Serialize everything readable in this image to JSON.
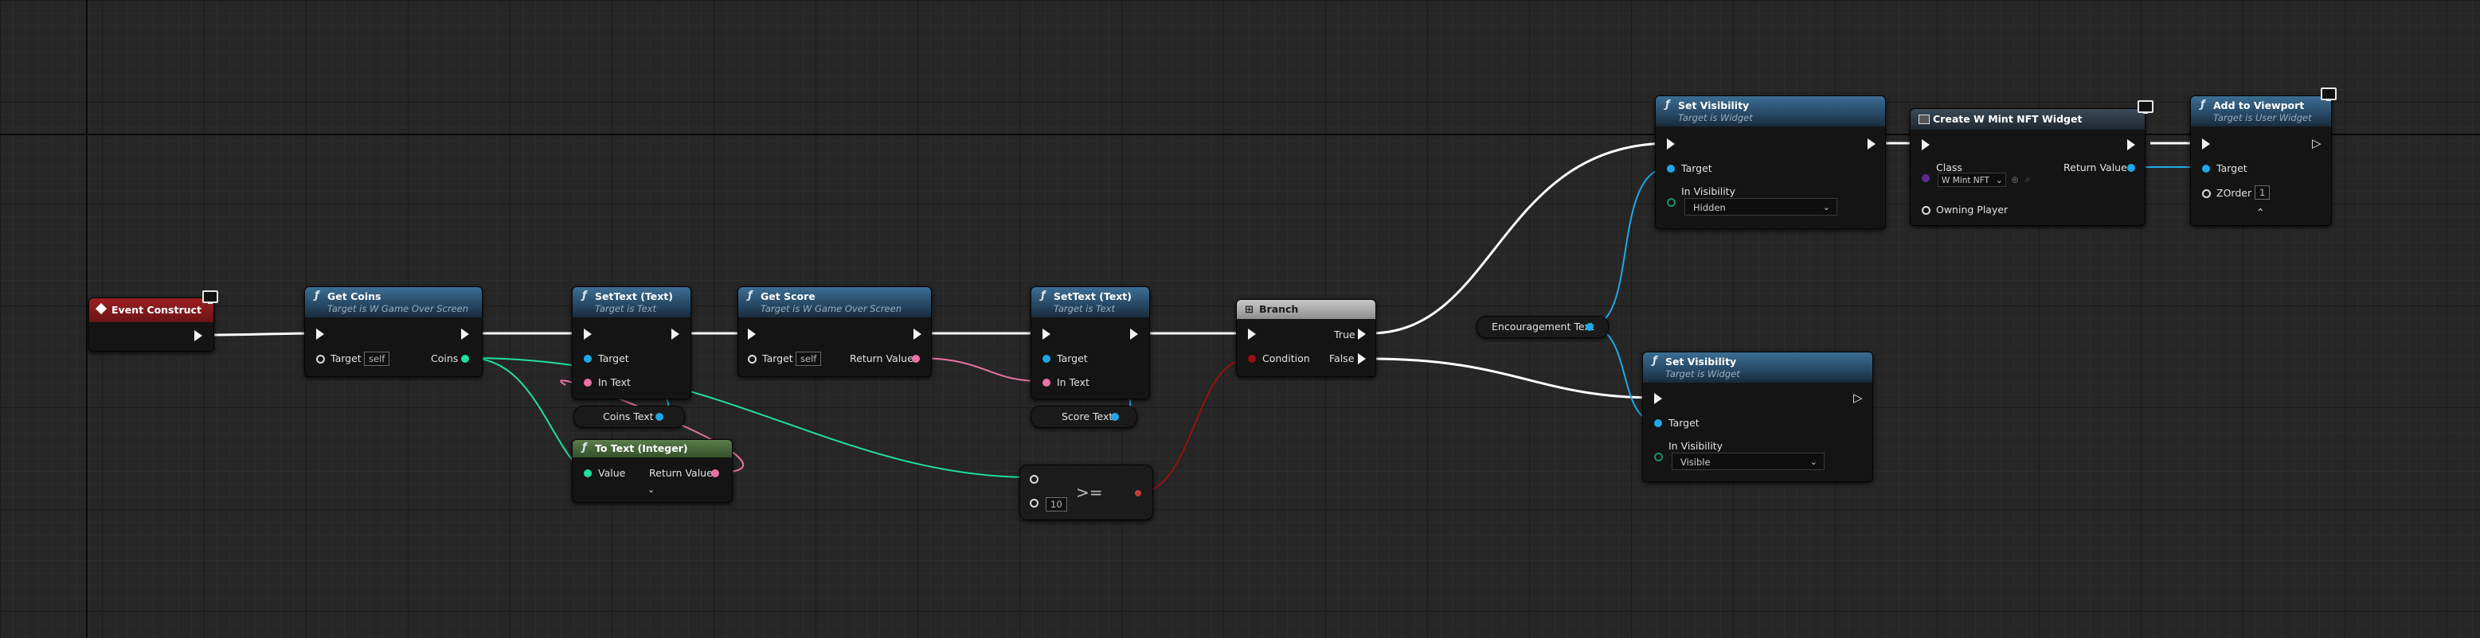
{
  "colors": {
    "canvas": "#262626",
    "exec_wire": "#ffffff",
    "object_pin": "#1fa8e6",
    "integer_pin": "#20dfa0",
    "text_pin": "#e873a4",
    "boolean_pin": "#9b0f0f",
    "function_header": "#3c6e93",
    "event_header": "#9c1f21",
    "conversion_header": "#5a7d4c"
  },
  "nodes": {
    "event_construct": {
      "title": "Event Construct",
      "icon": "event-diamond-icon"
    },
    "get_coins": {
      "title": "Get Coins",
      "subtitle": "Target is W Game Over Screen",
      "target_label": "Target",
      "target_value": "self",
      "output_label": "Coins"
    },
    "settext_coins": {
      "title": "SetText (Text)",
      "subtitle": "Target is Text",
      "target_label": "Target",
      "intext_label": "In Text"
    },
    "coins_text_var": {
      "label": "Coins Text"
    },
    "to_text_integer": {
      "title": "To Text (Integer)",
      "value_label": "Value",
      "return_label": "Return Value",
      "expand_icon": "chevron-down-icon"
    },
    "get_score": {
      "title": "Get Score",
      "subtitle": "Target is W Game Over Screen",
      "target_label": "Target",
      "target_value": "self",
      "return_label": "Return Value"
    },
    "settext_score": {
      "title": "SetText (Text)",
      "subtitle": "Target is Text",
      "target_label": "Target",
      "intext_label": "In Text"
    },
    "score_text_var": {
      "label": "Score Text"
    },
    "compare_gte": {
      "operator": ">=",
      "b_value": "10"
    },
    "branch": {
      "title": "Branch",
      "condition_label": "Condition",
      "true_label": "True",
      "false_label": "False"
    },
    "encouragement_text_var": {
      "label": "Encouragement Text"
    },
    "set_visibility_top": {
      "title": "Set Visibility",
      "subtitle": "Target is Widget",
      "target_label": "Target",
      "visibility_label": "In Visibility",
      "visibility_value": "Hidden"
    },
    "set_visibility_bottom": {
      "title": "Set Visibility",
      "subtitle": "Target is Widget",
      "target_label": "Target",
      "visibility_label": "In Visibility",
      "visibility_value": "Visible"
    },
    "create_widget": {
      "title": "Create W Mint NFT Widget",
      "class_label": "Class",
      "class_value": "W Mint NFT",
      "return_label": "Return Value",
      "owning_label": "Owning Player"
    },
    "add_to_viewport": {
      "title": "Add to Viewport",
      "subtitle": "Target is User Widget",
      "target_label": "Target",
      "zorder_label": "ZOrder",
      "zorder_value": "1",
      "expand_icon": "chevron-up-icon"
    }
  }
}
